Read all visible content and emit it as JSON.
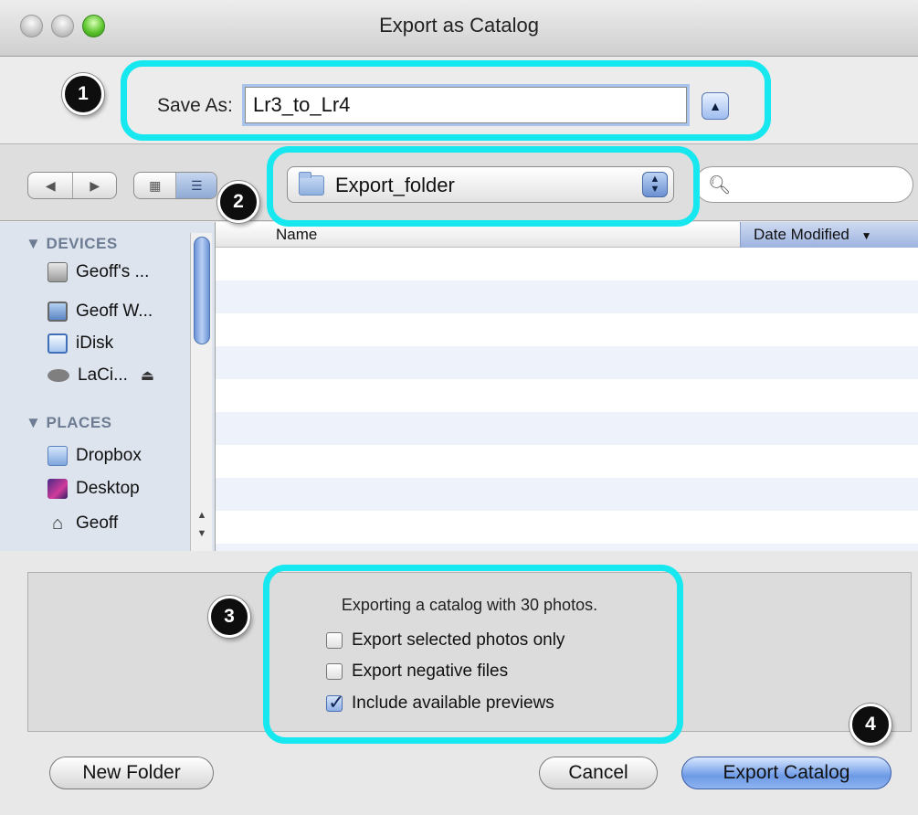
{
  "window": {
    "title": "Export as Catalog"
  },
  "save_as": {
    "label": "Save As:",
    "value": "Lr3_to_Lr4"
  },
  "toolbar": {
    "back_glyph": "◀",
    "forward_glyph": "▶",
    "icon_view_glyph": "▦",
    "list_view_glyph": "☰",
    "location": "Export_folder",
    "search_placeholder": ""
  },
  "sidebar": {
    "devices_header": "▼ DEVICES",
    "devices": [
      {
        "label": "Geoff's ...",
        "icon": "hard-drive-icon"
      },
      {
        "label": "Geoff W...",
        "icon": "monitor-icon"
      },
      {
        "label": "iDisk",
        "icon": "idisk-icon"
      },
      {
        "label": "LaCi...",
        "icon": "lacie-drive-icon"
      }
    ],
    "eject_glyph": "⏏",
    "places_header": "▼ PLACES",
    "places": [
      {
        "label": "Dropbox",
        "icon": "dropbox-folder-icon"
      },
      {
        "label": "Desktop",
        "icon": "desktop-icon"
      },
      {
        "label": "Geoff",
        "icon": "home-icon"
      }
    ]
  },
  "file_list": {
    "columns": [
      "Name",
      "Date Modified"
    ],
    "sort_glyph": "▼"
  },
  "options": {
    "summary": "Exporting a catalog with 30 photos.",
    "checkboxes": [
      {
        "label": "Export selected photos only",
        "checked": false
      },
      {
        "label": "Export negative files",
        "checked": false
      },
      {
        "label": "Include available previews",
        "checked": true
      }
    ]
  },
  "buttons": {
    "new_folder": "New Folder",
    "cancel": "Cancel",
    "export": "Export Catalog"
  },
  "callouts": [
    "1",
    "2",
    "3",
    "4"
  ],
  "colors": {
    "highlight": "#17e7ee",
    "badge": "#0e0e0e",
    "primary_button": "#6d9ae6"
  }
}
